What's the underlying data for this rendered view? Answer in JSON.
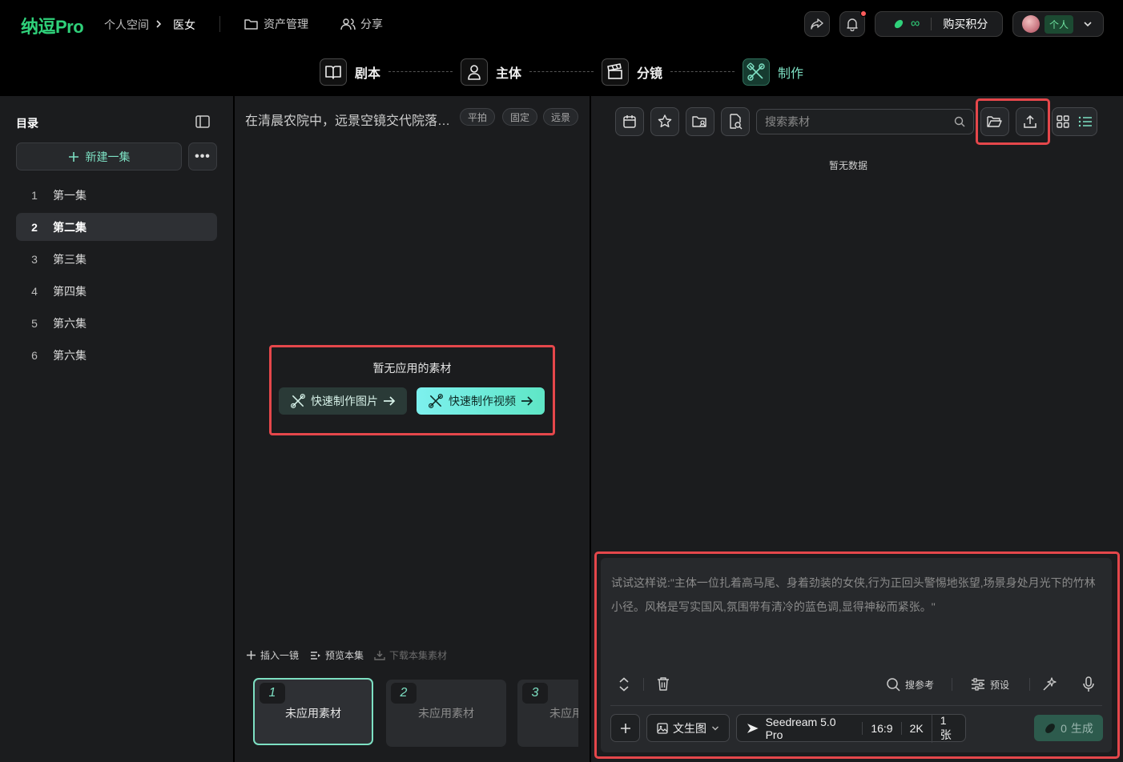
{
  "header": {
    "logo": "纳逗Pro",
    "breadcrumb": [
      "个人空间",
      "医女"
    ],
    "nav": [
      {
        "label": "资产管理"
      },
      {
        "label": "分享"
      }
    ],
    "credits": {
      "value": "∞",
      "buy_label": "购买积分"
    },
    "account": {
      "label": "个人"
    }
  },
  "steps": [
    {
      "label": "剧本",
      "active": false
    },
    {
      "label": "主体",
      "active": false
    },
    {
      "label": "分镜",
      "active": false
    },
    {
      "label": "制作",
      "active": true
    }
  ],
  "sidebar": {
    "title": "目录",
    "new_label": "新建一集",
    "more_label": "•••",
    "episodes": [
      {
        "num": "1",
        "label": "第一集"
      },
      {
        "num": "2",
        "label": "第二集"
      },
      {
        "num": "3",
        "label": "第三集"
      },
      {
        "num": "4",
        "label": "第四集"
      },
      {
        "num": "5",
        "label": "第六集"
      },
      {
        "num": "6",
        "label": "第六集"
      }
    ],
    "selected_index": 1
  },
  "scene": {
    "title": "在清晨农院中，远景空镜交代院落全貌",
    "tags": [
      "平拍",
      "固定",
      "远景"
    ],
    "empty_text": "暂无应用的素材",
    "quick_image_label": "快速制作图片",
    "quick_video_label": "快速制作视频",
    "actions": {
      "insert": "插入一镜",
      "preview": "预览本集",
      "download": "下载本集素材"
    },
    "shots": [
      {
        "num": "1",
        "label": "未应用素材"
      },
      {
        "num": "2",
        "label": "未应用素材"
      },
      {
        "num": "3",
        "label": "未应用素材"
      }
    ]
  },
  "assets": {
    "search_placeholder": "搜索素材",
    "empty_text": "暂无数据"
  },
  "prompt": {
    "placeholder": "试试这样说:\"主体一位扎着高马尾、身着劲装的女侠,行为正回头警惕地张望,场景身处月光下的竹林小径。风格是写实国风,氛围带有清冷的蓝色调,显得神秘而紧张。\"",
    "search_ref": "搜参考",
    "preset": "预设",
    "mode": "文生图",
    "model": "Seedream 5.0 Pro",
    "ratio": "16:9",
    "resolution": "2K",
    "count": "1张",
    "gen_cost": "0",
    "gen_label": "生成"
  },
  "colors": {
    "accent": "#7de0c3",
    "brand_green": "#2fd17a",
    "highlight_red": "#e5474b"
  }
}
